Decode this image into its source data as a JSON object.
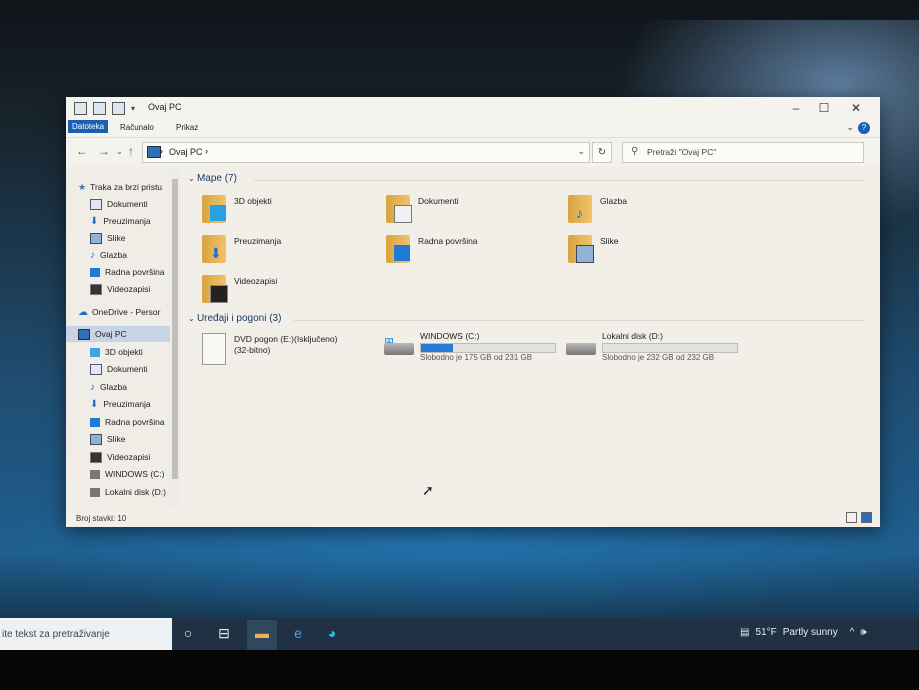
{
  "window": {
    "title": "Ovaj PC",
    "ribbon_tabs": [
      "Datoteka",
      "Računalo",
      "Prikaz"
    ],
    "address": "Ovaj PC",
    "search_placeholder": "Pretraži \"Ovaj PC\""
  },
  "sidebar": {
    "items": [
      {
        "label": "Traka za brzi pristu",
        "icon": "star-icon",
        "pinned": false
      },
      {
        "label": "Dokumenti",
        "icon": "document-icon",
        "pinned": true
      },
      {
        "label": "Preuzimanja",
        "icon": "download-icon",
        "pinned": true
      },
      {
        "label": "Slike",
        "icon": "pictures-icon",
        "pinned": true
      },
      {
        "label": "Glazba",
        "icon": "music-icon",
        "pinned": false
      },
      {
        "label": "Radna površina",
        "icon": "desktop-icon",
        "pinned": false
      },
      {
        "label": "Videozapisi",
        "icon": "video-icon",
        "pinned": false
      },
      {
        "label": "OneDrive - Persor",
        "icon": "cloud-icon",
        "pinned": false
      },
      {
        "label": "Ovaj PC",
        "icon": "pc-icon",
        "pinned": false
      },
      {
        "label": "3D objekti",
        "icon": "3d-icon",
        "pinned": false
      },
      {
        "label": "Dokumenti",
        "icon": "document-icon",
        "pinned": false
      },
      {
        "label": "Glazba",
        "icon": "music-icon",
        "pinned": false
      },
      {
        "label": "Preuzimanja",
        "icon": "download-icon",
        "pinned": false
      },
      {
        "label": "Radna površina",
        "icon": "desktop-icon",
        "pinned": false
      },
      {
        "label": "Slike",
        "icon": "pictures-icon",
        "pinned": false
      },
      {
        "label": "Videozapisi",
        "icon": "video-icon",
        "pinned": false
      },
      {
        "label": "WINDOWS (C:)",
        "icon": "drive-icon",
        "pinned": false
      },
      {
        "label": "Lokalni disk (D:)",
        "icon": "drive-icon",
        "pinned": false
      }
    ]
  },
  "folders_group": {
    "title": "Mape (7)",
    "items": [
      {
        "label": "3D objekti",
        "icon": "3d-folder-icon"
      },
      {
        "label": "Dokumenti",
        "icon": "documents-folder-icon"
      },
      {
        "label": "Glazba",
        "icon": "music-folder-icon"
      },
      {
        "label": "Preuzimanja",
        "icon": "downloads-folder-icon"
      },
      {
        "label": "Radna površina",
        "icon": "desktop-folder-icon"
      },
      {
        "label": "Slike",
        "icon": "pictures-folder-icon"
      },
      {
        "label": "Videozapisi",
        "icon": "videos-folder-icon"
      }
    ]
  },
  "devices_group": {
    "title": "Uređaji i pogoni (3)",
    "dvd": {
      "label": "DVD pogon (E:)(Isključeno)",
      "sub": "(32-bitno)"
    },
    "drives": [
      {
        "label": "WINDOWS (C:)",
        "free": "Slobodno je 175 GB od 231 GB",
        "used_fraction": 0.24
      },
      {
        "label": "Lokalni disk (D:)",
        "free": "Slobodno je 232 GB od 232 GB",
        "used_fraction": 0.0
      }
    ]
  },
  "status": {
    "count": "Broj stavki: 10"
  },
  "taskbar": {
    "search_text": "ite tekst za pretraživanje",
    "temperature": "51°F",
    "weather": "Partly sunny"
  },
  "colors": {
    "accent": "#1a5fb4",
    "folder": "#e6b35a",
    "bar": "#2a7bd6"
  }
}
